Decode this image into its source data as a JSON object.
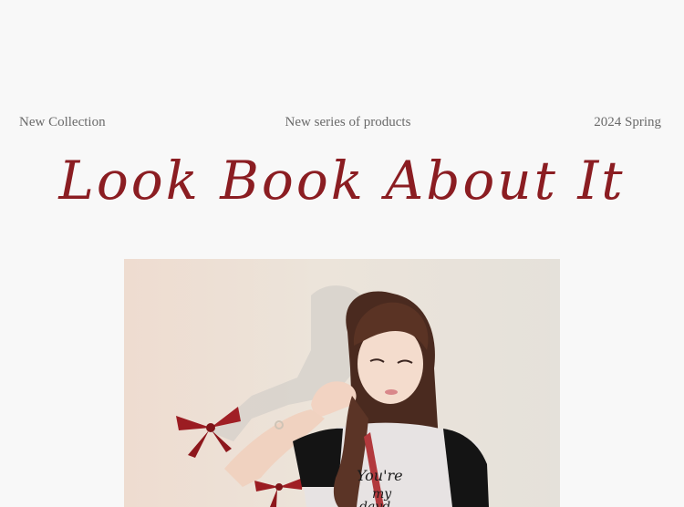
{
  "header": {
    "left": "New Collection",
    "center": "New series of products",
    "right": "2024 Spring"
  },
  "title": "Look  Book  About  It",
  "photo": {
    "shirt_text_line1": "You're",
    "shirt_text_line2": "my",
    "shirt_text_line3": "dayd"
  },
  "colors": {
    "accent": "#8b1d22",
    "background": "#f8f8f8",
    "text": "#6a6a6a"
  }
}
